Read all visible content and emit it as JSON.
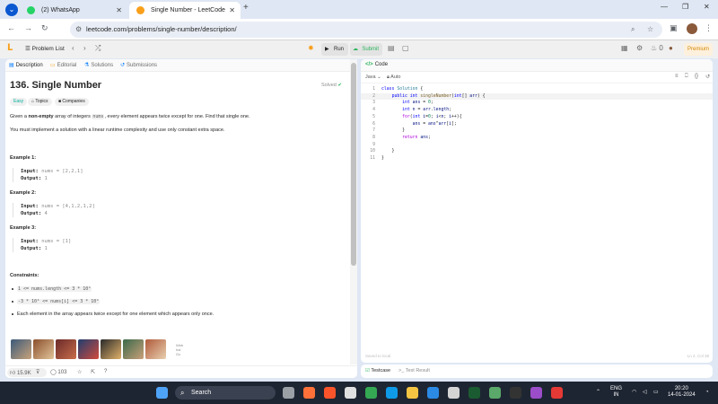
{
  "browser": {
    "tabs": [
      {
        "label": "(2) WhatsApp",
        "favicon_color": "#25d366"
      },
      {
        "label": "Single Number - LeetCode",
        "favicon_color": "#f89f1b"
      }
    ],
    "url": "leetcode.com/problems/single-number/description/"
  },
  "lc_nav": {
    "problem_list": "Problem List",
    "run": "Run",
    "submit": "Submit",
    "streak": "0",
    "premium": "Premium"
  },
  "left_tabs": [
    "Description",
    "Editorial",
    "Solutions",
    "Submissions"
  ],
  "question": {
    "title": "136. Single Number",
    "status": "Solved",
    "tags": [
      "Easy",
      "Topics",
      "Companies"
    ],
    "desc_pre": "Given a ",
    "desc_bold": "non-empty",
    "desc_mid": " array of integers ",
    "desc_code": "nums",
    "desc_post": ", every element appears twice except for one. Find that single one.",
    "constraint_note": "You must implement a solution with a linear runtime complexity and use only constant extra space.",
    "examples": [
      {
        "heading": "Example 1:",
        "input_label": "Input:",
        "input": "nums = [2,2,1]",
        "output_label": "Output:",
        "output": "1"
      },
      {
        "heading": "Example 2:",
        "input_label": "Input:",
        "input": "nums = [4,1,2,1,2]",
        "output_label": "Output:",
        "output": "4"
      },
      {
        "heading": "Example 3:",
        "input_label": "Input:",
        "input": "nums = [1]",
        "output_label": "Output:",
        "output": "1"
      }
    ],
    "constraints_heading": "Constraints:",
    "constraints": [
      "1 <= nums.length <= 3 * 10⁴",
      "-3 * 10⁴ <= nums[i] <= 3 * 10⁴",
      "Each element in the array appears twice except for one element which appears only once."
    ],
    "ad_text": "Web hai Gx"
  },
  "footer": {
    "likes": "15.9K",
    "comments": "103"
  },
  "editor": {
    "title": "Code",
    "language": "Java",
    "mode": "Auto",
    "lines": [
      "class Solution {",
      "    public int singleNumber(int[] arr) {",
      "        int ans = 0;",
      "        int n = arr.length;",
      "        for(int i=0; i<n; i++){",
      "            ans = ans^arr[i];",
      "        }",
      "        return ans;",
      "",
      "    }",
      "}"
    ],
    "saved": "Saved to local",
    "cursor": "Ln 2, Col 38"
  },
  "test_tabs": [
    "Testcase",
    "Test Result"
  ],
  "taskbar": {
    "search": "Search",
    "lang": "ENG",
    "region": "IN",
    "time": "20:20",
    "date": "14-01-2024"
  }
}
